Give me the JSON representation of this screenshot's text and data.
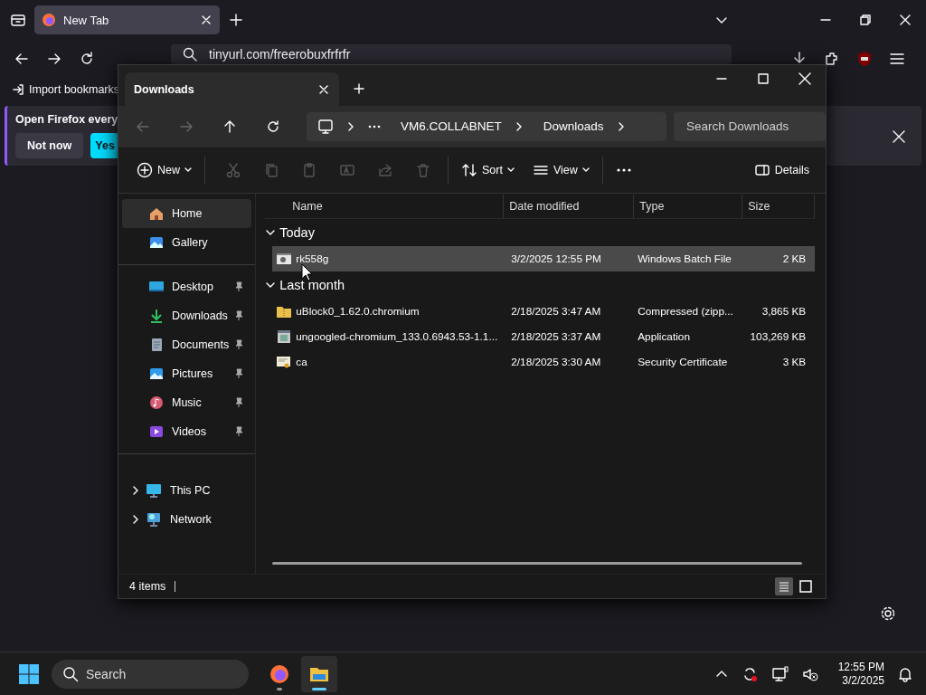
{
  "browser": {
    "tabs": [
      {
        "title": "New Tab",
        "selected": true
      }
    ],
    "url": "tinyurl.com/freerobuxfrfrfr",
    "bookmarks": [
      {
        "label": "Import bookmarks"
      }
    ],
    "notification": {
      "message": "Open Firefox every",
      "buttons": [
        {
          "label": "Not now",
          "kind": "secondary"
        },
        {
          "label": "Yes",
          "kind": "primary"
        }
      ]
    }
  },
  "explorer": {
    "tabs": [
      {
        "title": "Downloads",
        "selected": true
      }
    ],
    "nav": [
      {
        "kind": "back",
        "disabled": true
      },
      {
        "kind": "forward",
        "disabled": true
      },
      {
        "kind": "up",
        "disabled": false
      },
      {
        "kind": "refresh",
        "disabled": false
      }
    ],
    "breadcrumb": [
      "VM6.COLLABNET",
      "Downloads"
    ],
    "search": {
      "placeholder": "Search Downloads"
    },
    "toolbar": [
      {
        "kind": "new",
        "label": "New",
        "disabled": false
      },
      {
        "kind": "cut",
        "disabled": true
      },
      {
        "kind": "copy",
        "disabled": true
      },
      {
        "kind": "paste",
        "disabled": true
      },
      {
        "kind": "rename",
        "disabled": true
      },
      {
        "kind": "share",
        "disabled": true
      },
      {
        "kind": "delete",
        "disabled": true
      },
      {
        "kind": "sort",
        "label": "Sort",
        "disabled": false
      },
      {
        "kind": "view",
        "label": "View",
        "disabled": false
      },
      {
        "kind": "more",
        "disabled": false
      },
      {
        "kind": "details",
        "label": "Details",
        "disabled": false
      }
    ],
    "sidebar": [
      {
        "items": [
          {
            "kind": "home",
            "label": "Home",
            "selected": true
          },
          {
            "kind": "gallery",
            "label": "Gallery",
            "selected": false
          }
        ]
      },
      {
        "items": [
          {
            "kind": "desktop",
            "label": "Desktop",
            "selected": false,
            "pinned": true
          },
          {
            "kind": "downloads",
            "label": "Downloads",
            "selected": false,
            "pinned": true
          },
          {
            "kind": "documents",
            "label": "Documents",
            "selected": false,
            "pinned": true
          },
          {
            "kind": "pictures",
            "label": "Pictures",
            "selected": false,
            "pinned": true
          },
          {
            "kind": "music",
            "label": "Music",
            "selected": false,
            "pinned": true
          },
          {
            "kind": "videos",
            "label": "Videos",
            "selected": false,
            "pinned": true
          }
        ]
      },
      {
        "items": [
          {
            "kind": "pc",
            "label": "This PC",
            "selected": false,
            "expanded": false
          },
          {
            "kind": "network",
            "label": "Network",
            "selected": false,
            "expanded": false
          }
        ]
      }
    ],
    "columns": [
      "Name",
      "Date modified",
      "Type",
      "Size"
    ],
    "groups": [
      {
        "label": "Today",
        "expanded": true,
        "rows": [
          {
            "kind": "batch",
            "name": "rk558g",
            "date": "3/2/2025 12:55 PM",
            "type": "Windows Batch File",
            "size": "2 KB",
            "selected": true
          }
        ]
      },
      {
        "label": "Last month",
        "expanded": true,
        "rows": [
          {
            "kind": "zip",
            "name": "uBlock0_1.62.0.chromium",
            "date": "2/18/2025 3:47 AM",
            "type": "Compressed (zipp...",
            "size": "3,865 KB",
            "selected": false
          },
          {
            "kind": "app",
            "name": "ungoogled-chromium_133.0.6943.53-1.1...",
            "date": "2/18/2025 3:37 AM",
            "type": "Application",
            "size": "103,269 KB",
            "selected": false
          },
          {
            "kind": "cert",
            "name": "ca",
            "date": "2/18/2025 3:30 AM",
            "type": "Security Certificate",
            "size": "3 KB",
            "selected": false
          }
        ]
      }
    ],
    "status": "4 items",
    "view_modes": [
      {
        "kind": "details",
        "selected": true
      },
      {
        "kind": "tiles",
        "selected": false
      }
    ]
  },
  "taskbar": {
    "search": {
      "placeholder": "Search"
    },
    "apps": [
      {
        "kind": "firefox",
        "selected": false
      },
      {
        "kind": "explorer",
        "selected": true
      }
    ],
    "time": "12:55 PM",
    "date": "3/2/2025"
  }
}
